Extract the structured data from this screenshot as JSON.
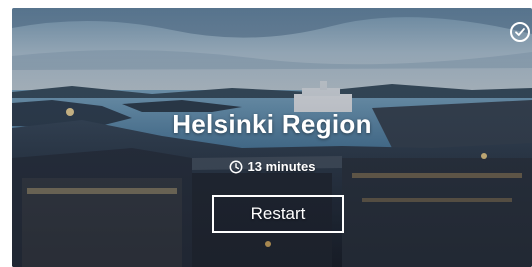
{
  "card": {
    "title": "Helsinki Region",
    "duration": "13 minutes",
    "restart_label": "Restart"
  },
  "icons": {
    "status": "check-circle-icon",
    "duration": "clock-icon"
  },
  "colors": {
    "text": "#ffffff",
    "sky_top": "#6f8fa8",
    "sea": "#5d8fb1",
    "city_dark": "#2a2f3a"
  }
}
